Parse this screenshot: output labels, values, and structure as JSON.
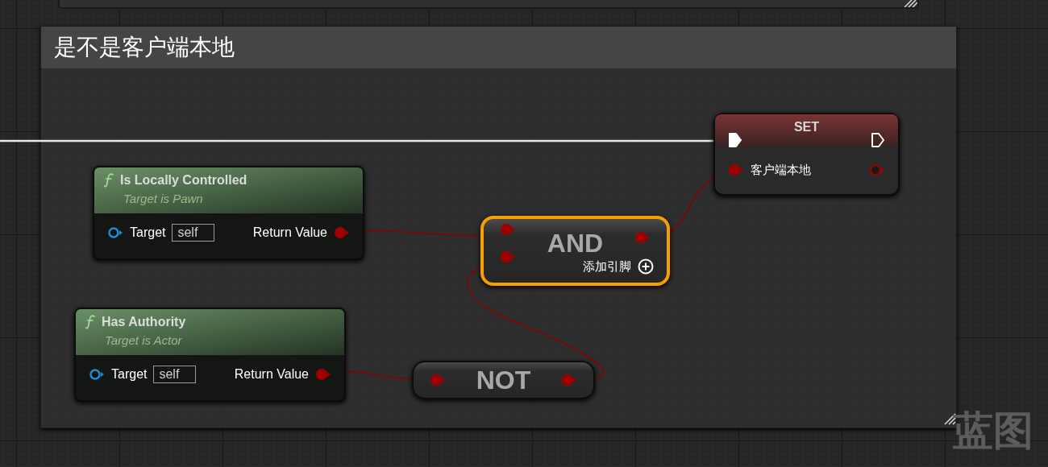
{
  "comment_box": {
    "title": "是不是客户端本地"
  },
  "nodes": [
    {
      "kind": "function",
      "title": "Is Locally Controlled",
      "subtitle": "Target is Pawn",
      "input_label": "Target",
      "input_value": "self",
      "output_label": "Return Value",
      "selected": false
    },
    {
      "kind": "function",
      "title": "Has Authority",
      "subtitle": "Target is Actor",
      "input_label": "Target",
      "input_value": "self",
      "output_label": "Return Value",
      "selected": false
    },
    {
      "kind": "set",
      "title": "SET",
      "variable": "客户端本地",
      "selected": false
    },
    {
      "kind": "operator",
      "title": "AND",
      "add_pin": "添加引脚",
      "selected": true
    },
    {
      "kind": "operator",
      "title": "NOT",
      "selected": false
    }
  ],
  "graph_label": "蓝图"
}
